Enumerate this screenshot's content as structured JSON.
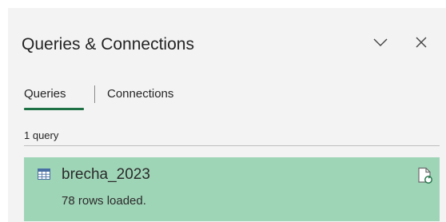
{
  "pane": {
    "title": "Queries & Connections",
    "collapse_icon": "chevron-down-icon",
    "close_icon": "close-icon"
  },
  "tabs": [
    {
      "label": "Queries",
      "active": true
    },
    {
      "label": "Connections",
      "active": false
    }
  ],
  "query_count": "1 query",
  "queries": [
    {
      "name": "brecha_2023",
      "status": "78 rows loaded.",
      "icon": "table-icon",
      "action_icon": "refresh-document-icon"
    }
  ],
  "colors": {
    "accent": "#1e7145",
    "selected_row": "#9fd5b7",
    "pane_bg": "#f3f3f3"
  }
}
